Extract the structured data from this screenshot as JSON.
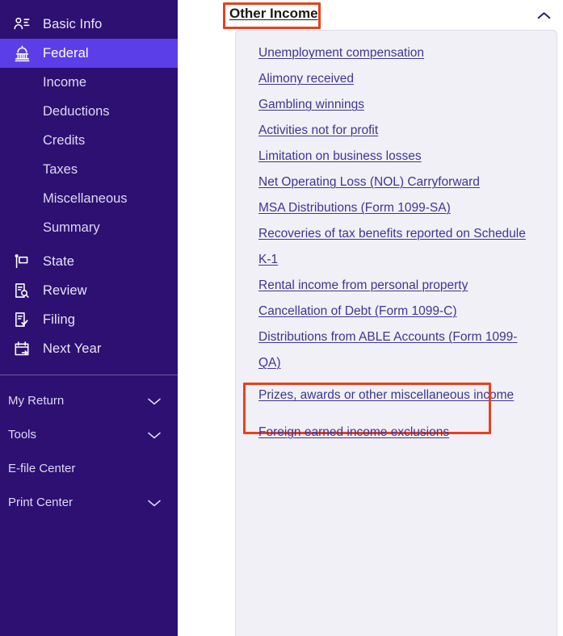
{
  "sidebar": {
    "primary_items": [
      {
        "label": "Basic Info",
        "icon": "profile-card-icon",
        "active": false
      },
      {
        "label": "Federal",
        "icon": "capitol-building-icon",
        "active": true
      }
    ],
    "federal_subitems": [
      {
        "label": "Income"
      },
      {
        "label": "Deductions"
      },
      {
        "label": "Credits"
      },
      {
        "label": "Taxes"
      },
      {
        "label": "Miscellaneous"
      },
      {
        "label": "Summary"
      }
    ],
    "secondary_items": [
      {
        "label": "State",
        "icon": "flag-icon"
      },
      {
        "label": "Review",
        "icon": "document-search-icon"
      },
      {
        "label": "Filing",
        "icon": "document-check-icon"
      },
      {
        "label": "Next Year",
        "icon": "calendar-arrow-icon"
      }
    ],
    "footer_items": [
      {
        "label": "My Return",
        "has_chevron": true
      },
      {
        "label": "Tools",
        "has_chevron": true
      },
      {
        "label": "E-file Center",
        "has_chevron": false
      },
      {
        "label": "Print Center",
        "has_chevron": true
      }
    ]
  },
  "section": {
    "title": "Other Income",
    "collapse_icon": "chevron-up-icon",
    "links": [
      {
        "label": "Unemployment compensation"
      },
      {
        "label": "Alimony received"
      },
      {
        "label": "Gambling winnings"
      },
      {
        "label": "Activities not for profit"
      },
      {
        "label": "Limitation on business losses"
      },
      {
        "label": "Net Operating Loss (NOL) Carryforward"
      },
      {
        "label": "MSA Distributions (Form 1099-SA)"
      },
      {
        "label": "Recoveries of tax benefits reported on Schedule K-1"
      },
      {
        "label": "Rental income from personal property"
      },
      {
        "label": "Cancellation of Debt (Form 1099-C)"
      },
      {
        "label": "Distributions from ABLE Accounts (Form 1099-QA)"
      },
      {
        "label": "Prizes, awards or other miscellaneous income",
        "highlighted": true
      },
      {
        "label": "Foreign earned income exclusions"
      }
    ]
  },
  "colors": {
    "sidebar_bg": "#2d1072",
    "active_item_bg": "#5b3ee8",
    "annotation_red": "#e8411c",
    "link_text": "#3f3594",
    "card_bg": "#f1f0f7"
  }
}
